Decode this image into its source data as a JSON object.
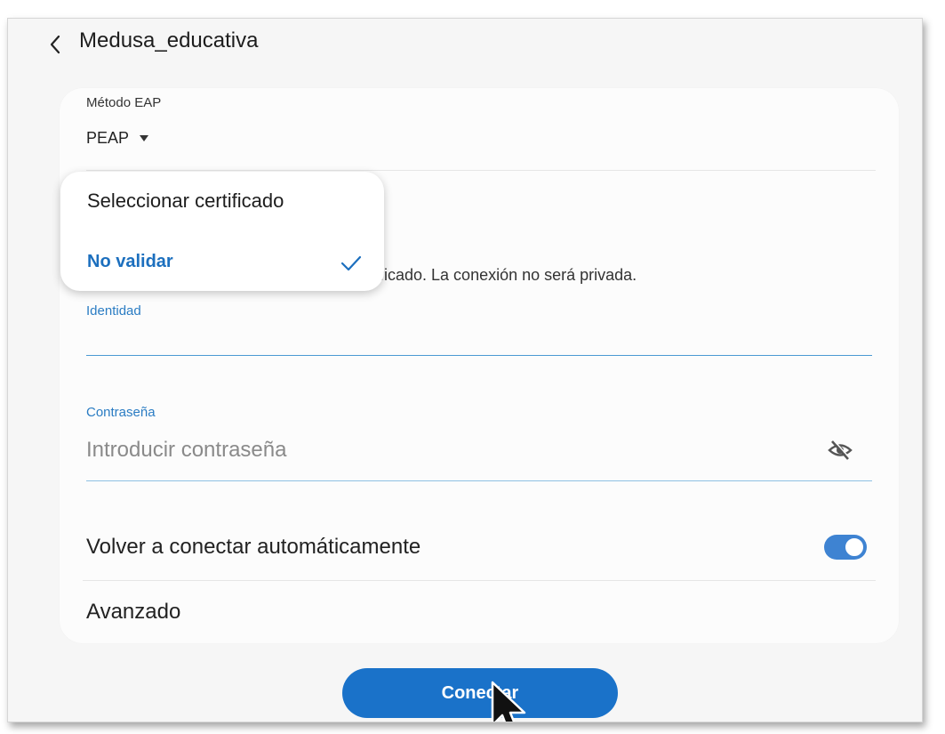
{
  "header": {
    "title": "Medusa_educativa"
  },
  "eap": {
    "label": "Método EAP",
    "value": "PEAP"
  },
  "certificate": {
    "hint_text": "ficado. La conexión no será privada.",
    "options": [
      {
        "label": "Seleccionar certificado",
        "selected": false
      },
      {
        "label": "No validar",
        "selected": true
      }
    ]
  },
  "identity": {
    "label": "Identidad",
    "value": ""
  },
  "password": {
    "label": "Contraseña",
    "placeholder": "Introducir contraseña"
  },
  "reconnect": {
    "label": "Volver a conectar automáticamente",
    "enabled": true
  },
  "advanced": {
    "label": "Avanzado"
  },
  "connect": {
    "label": "Conectar"
  },
  "colors": {
    "accent": "#1a72c9",
    "toggle_on": "#3e83d2",
    "label_blue": "#2a7cc3"
  },
  "icons": [
    "back-chevron-icon",
    "dropdown-caret-icon",
    "checkmark-icon",
    "eye-off-icon",
    "mouse-pointer-icon"
  ]
}
